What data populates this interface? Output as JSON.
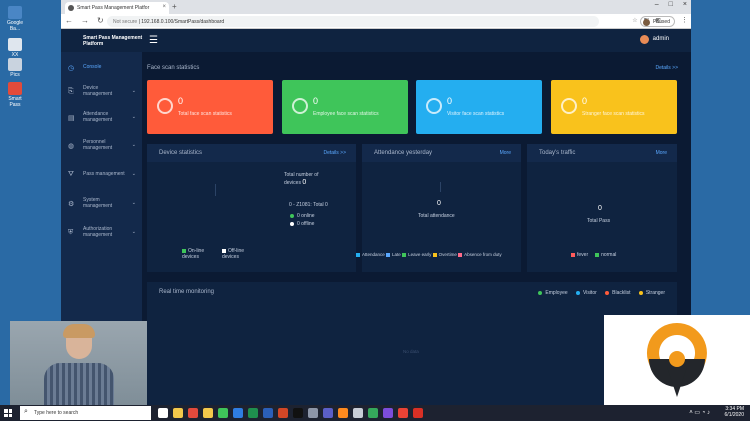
{
  "desktop_icons": [
    {
      "label": "Google Ba..."
    },
    {
      "label": "XX"
    },
    {
      "label": "Pics"
    },
    {
      "label": "Smart Pass"
    }
  ],
  "browser": {
    "tab_title": "Smart Pass Management Platfor",
    "tab_close": "×",
    "new_tab": "+",
    "window_controls": {
      "min": "–",
      "max": "□",
      "close": "×"
    },
    "nav": {
      "back": "←",
      "forward": "→",
      "reload": "↻"
    },
    "url_prefix": "Not secure",
    "url": "192.168.0.100/SmartPass/dashboard",
    "profile_label": "Paused",
    "menu": "⋮"
  },
  "app": {
    "logo": "Smart Pass Management Platform",
    "hamburger": "☰",
    "user_name": "admin",
    "sidebar": [
      {
        "label": "Console",
        "icon": "◷",
        "active": true,
        "has_chevron": false
      },
      {
        "label": "Device management",
        "icon": "⎘",
        "active": false,
        "has_chevron": true
      },
      {
        "label": "Attendance management",
        "icon": "▤",
        "active": false,
        "has_chevron": true
      },
      {
        "label": "Personnel management",
        "icon": "◍",
        "active": false,
        "has_chevron": true
      },
      {
        "label": "Pass management",
        "icon": "⛛",
        "active": false,
        "has_chevron": true
      },
      {
        "label": "System management",
        "icon": "⚙",
        "active": false,
        "has_chevron": true
      },
      {
        "label": "Authorization management",
        "icon": "⛨",
        "active": false,
        "has_chevron": true
      }
    ],
    "chevron": "⌄",
    "face_scan": {
      "title": "Face scan statistics",
      "details": "Details >>",
      "cards": [
        {
          "value": "0",
          "label": "Total face scan statistics",
          "color": "#ff5b3a"
        },
        {
          "value": "0",
          "label": "Employee face scan statistics",
          "color": "#3fc55a"
        },
        {
          "value": "0",
          "label": "Visitor face scan statistics",
          "color": "#24aef0"
        },
        {
          "value": "0",
          "label": "Stranger face scan statistics",
          "color": "#f9c21c"
        }
      ]
    },
    "device_stats": {
      "title": "Device statistics",
      "details": "Details >>",
      "total_label": "Total number of devices",
      "total_value": "0",
      "range_text": "0 - Z1081: Total 0",
      "online_text": "0 online",
      "offline_text": "0 offline",
      "legend_online": "On-line devices",
      "legend_offline": "Off-line devices",
      "online_color": "#3fc55a",
      "offline_color": "#ffffff"
    },
    "attendance": {
      "title": "Attendance yesterday",
      "more": "More",
      "value": "0",
      "label": "Total attendance",
      "legend": [
        {
          "label": "Attendance",
          "color": "#24aef0"
        },
        {
          "label": "Late",
          "color": "#5aa8ff"
        },
        {
          "label": "Leave early",
          "color": "#3fc55a"
        },
        {
          "label": "Overtime",
          "color": "#f9c21c"
        },
        {
          "label": "Absence from duty",
          "color": "#ff6b8a"
        }
      ]
    },
    "traffic": {
      "title": "Today's traffic",
      "more": "More",
      "value": "0",
      "label": "Total Pass",
      "legend": [
        {
          "label": "fever",
          "color": "#ff5b5b"
        },
        {
          "label": "normal",
          "color": "#3fc55a"
        }
      ]
    },
    "monitoring": {
      "title": "Real time monitoring",
      "legend": [
        {
          "label": "Employee",
          "color": "#3fc55a"
        },
        {
          "label": "Visitor",
          "color": "#24aef0"
        },
        {
          "label": "Blacklist",
          "color": "#ff5b3a"
        },
        {
          "label": "Stranger",
          "color": "#f9c21c"
        }
      ],
      "empty_text": "No data"
    }
  },
  "taskbar": {
    "search_placeholder": "Type here to search",
    "search_icon": "⌕",
    "time": "3:34 PM",
    "date": "6/1/2020",
    "tray_icons": "˄ ▭ ◔ ♪",
    "apps": [
      {
        "name": "task-view",
        "color": "#ffffff"
      },
      {
        "name": "file-explorer",
        "color": "#f3c84b"
      },
      {
        "name": "chrome",
        "color": "#e34a3c"
      },
      {
        "name": "files",
        "color": "#f3c84b"
      },
      {
        "name": "sheets",
        "color": "#3fc55a"
      },
      {
        "name": "store",
        "color": "#2f7de1"
      },
      {
        "name": "excel",
        "color": "#1f8f4e"
      },
      {
        "name": "word",
        "color": "#2b5fb8"
      },
      {
        "name": "powerpoint",
        "color": "#d24726"
      },
      {
        "name": "app-black",
        "color": "#111111"
      },
      {
        "name": "app-gray",
        "color": "#8d96a8"
      },
      {
        "name": "teams",
        "color": "#5b5fc7"
      },
      {
        "name": "firefox",
        "color": "#ff8a1f"
      },
      {
        "name": "settings",
        "color": "#c8cdd6"
      },
      {
        "name": "drive",
        "color": "#35a85b"
      },
      {
        "name": "media",
        "color": "#7c4ddb"
      },
      {
        "name": "mail",
        "color": "#ea4335"
      },
      {
        "name": "gmail",
        "color": "#d93025"
      }
    ]
  }
}
